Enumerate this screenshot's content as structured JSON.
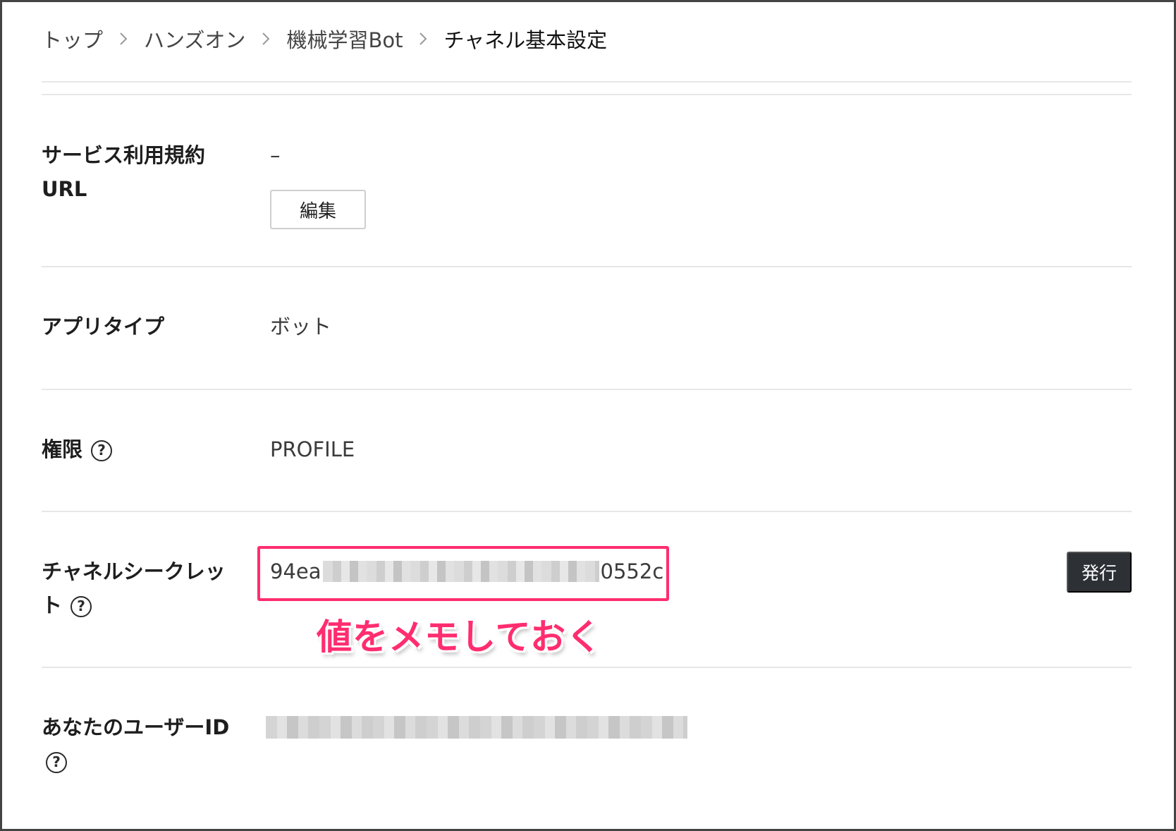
{
  "breadcrumb": {
    "items": [
      "トップ",
      "ハンズオン",
      "機械学習Bot",
      "チャネル基本設定"
    ]
  },
  "rows": {
    "terms_url": {
      "label_line1": "サービス利用規約",
      "label_line2": "URL",
      "value": "–",
      "edit_button": "編集"
    },
    "app_type": {
      "label": "アプリタイプ",
      "value": "ボット"
    },
    "permissions": {
      "label": "権限",
      "value": "PROFILE"
    },
    "channel_secret": {
      "label_line1": "チャネルシークレッ",
      "label_line2": "ト",
      "value_prefix": "94ea",
      "value_suffix": "0552c",
      "issue_button": "発行",
      "annotation": "値をメモしておく"
    },
    "user_id": {
      "label_line1": "あなたのユーザーID"
    }
  },
  "icons": {
    "help": "question-circle-icon",
    "breadcrumb_separator": "chevron-right-icon"
  },
  "colors": {
    "accent": "#ff2d6f",
    "primary_button": "#2d3135"
  }
}
